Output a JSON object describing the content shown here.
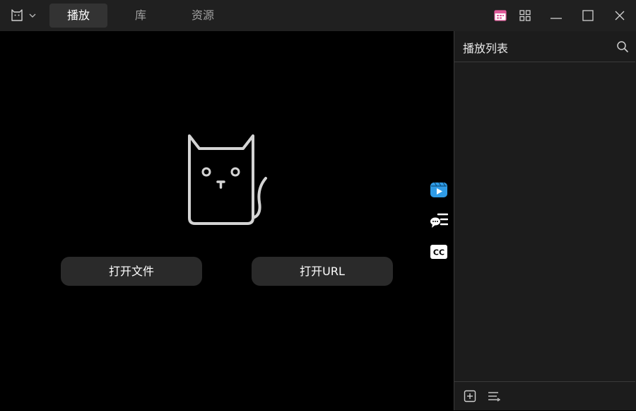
{
  "titlebar": {
    "tabs": [
      {
        "label": "播放",
        "active": true
      },
      {
        "label": "库",
        "active": false
      },
      {
        "label": "资源",
        "active": false
      }
    ],
    "icons": [
      "cat-logo-icon",
      "chevron-down-icon",
      "calendar-icon",
      "grid-icon",
      "minimize-icon",
      "maximize-icon",
      "close-icon"
    ]
  },
  "player": {
    "open_file_label": "打开文件",
    "open_url_label": "打开URL",
    "side_icons": [
      "video-clips-icon",
      "danmaku-icon",
      "subtitles-cc-icon"
    ]
  },
  "playlist": {
    "title": "播放列表",
    "items": [],
    "footer_icons": [
      "add-icon",
      "sort-list-icon"
    ]
  },
  "colors": {
    "titlebar_bg": "#202020",
    "player_bg": "#000000",
    "panel_bg": "#1c1c1c",
    "button_bg": "#2a2a2a",
    "accent_blue": "#2f9be6"
  }
}
